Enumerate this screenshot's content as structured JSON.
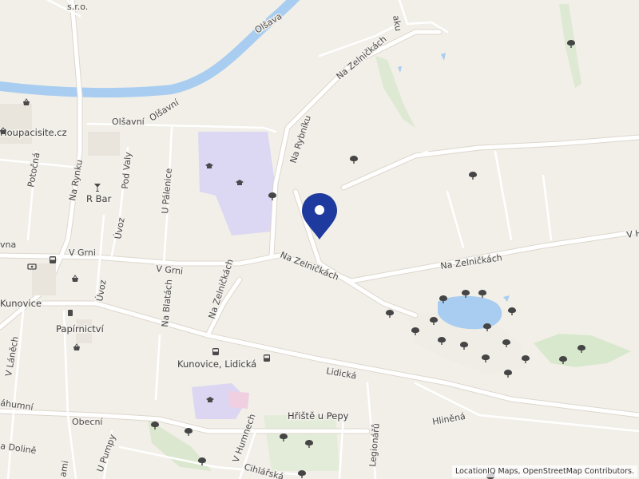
{
  "map": {
    "attribution": "LocationIQ Maps, OpenStreetMap Contributors.",
    "marker": {
      "name": "location-pin"
    },
    "colors": {
      "background": "#f2efe9",
      "river": "#a8cdf0",
      "road": "#ffffff",
      "park": "#d9ead3",
      "school": "#dcd7f2",
      "marker": "#1f3a9e"
    },
    "labels": {
      "sro": "s.r.o.",
      "olsava_river": "Olšava",
      "olsavni_1": "Olšavní",
      "olsavni_2": "Olšavní",
      "houpacisite": "Houpacisite.cz",
      "potocna": "Potočná",
      "na_rynku": "Na Rynku",
      "pod_valy": "Pod Valy",
      "u_palenice": "U Pálenice",
      "r_bar": "R Bar",
      "uvoz_1": "Úvoz",
      "uvoz_2": "Úvoz",
      "vna": "vna",
      "v_grni_1": "V Grni",
      "v_grni_2": "V Grni",
      "kunovice": "Kunovice",
      "na_blatach": "Na Blatách",
      "na_zelnickach_1": "Na Zelničkách",
      "na_zelnickach_2": "Na Zelničkách",
      "na_zelnickach_3": "Na Zelničkách",
      "na_zelnickach_4": "Na Zelničkách",
      "na_rybniku": "Na Rybníku",
      "papirnictvi": "Papírnictví",
      "v_lanech": "V Láněch",
      "kunovice_lidicka": "Kunovice, Lidická",
      "lidicka": "Lidická",
      "zahumni": "áhumní",
      "obecni": "Obecní",
      "v_humnech": "V Humnech",
      "hriste_u_pepy": "Hřiště u Pepy",
      "hlinena": "Hliněná",
      "legionaru": "Legionářů",
      "u_pumpy": "U Pumpy",
      "dolinach": "a Dolině",
      "cihlarska": "Cihlářská",
      "ami": "ami",
      "aku": "aku",
      "v_h": "V H"
    }
  }
}
